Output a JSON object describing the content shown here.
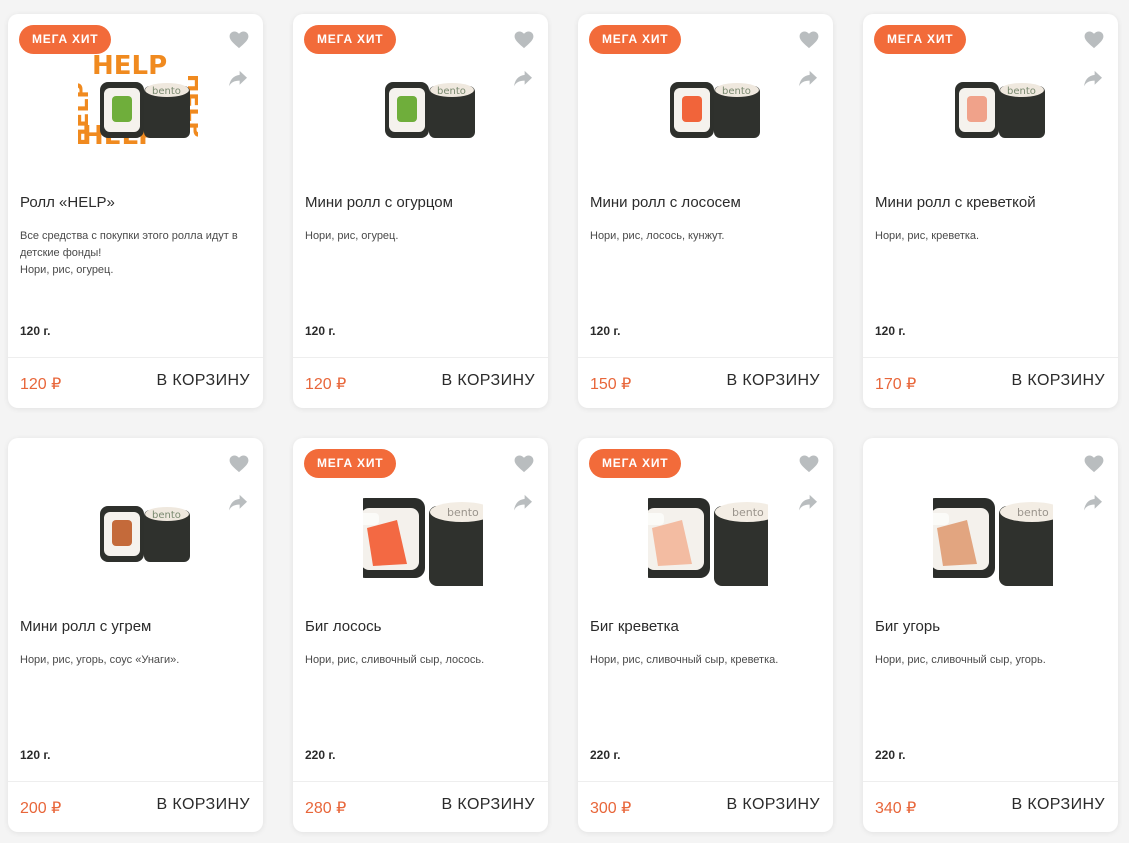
{
  "colors": {
    "accent": "#f26b3a",
    "price": "#e8663a",
    "icon": "#b9bdbf"
  },
  "products": [
    {
      "badge": "МЕГА ХИТ",
      "title": "Ролл «HELP»",
      "description": "Все средства с покупки этого ролла идут в детские фонды!\nНори, рис, огурец.",
      "weight": "120 г.",
      "price": "120 ₽",
      "cart": "В КОРЗИНУ",
      "filling": "cucumber",
      "watermark": "HELP"
    },
    {
      "badge": "МЕГА ХИТ",
      "title": "Мини ролл с огурцом",
      "description": "Нори, рис, огурец.",
      "weight": "120 г.",
      "price": "120 ₽",
      "cart": "В КОРЗИНУ",
      "filling": "cucumber"
    },
    {
      "badge": "МЕГА ХИТ",
      "title": "Мини ролл с лососем",
      "description": "Нори, рис, лосось, кунжут.",
      "weight": "120 г.",
      "price": "150 ₽",
      "cart": "В КОРЗИНУ",
      "filling": "salmon"
    },
    {
      "badge": "МЕГА ХИТ",
      "title": "Мини ролл с креветкой",
      "description": "Нори, рис, креветка.",
      "weight": "120 г.",
      "price": "170 ₽",
      "cart": "В КОРЗИНУ",
      "filling": "shrimp"
    },
    {
      "badge": "",
      "title": "Мини ролл с угрем",
      "description": "Нори, рис, угорь, соус «Унаги».",
      "weight": "120 г.",
      "price": "200 ₽",
      "cart": "В КОРЗИНУ",
      "filling": "eel"
    },
    {
      "badge": "МЕГА ХИТ",
      "title": "Биг лосось",
      "description": "Нори, рис, сливочный сыр, лосось.",
      "weight": "220 г.",
      "price": "280 ₽",
      "cart": "В КОРЗИНУ",
      "filling": "salmon-big"
    },
    {
      "badge": "МЕГА ХИТ",
      "title": "Биг креветка",
      "description": "Нори, рис, сливочный сыр, креветка.",
      "weight": "220 г.",
      "price": "300 ₽",
      "cart": "В КОРЗИНУ",
      "filling": "shrimp-big"
    },
    {
      "badge": "",
      "title": "Биг угорь",
      "description": "Нори, рис, сливочный сыр, угорь.",
      "weight": "220 г.",
      "price": "340 ₽",
      "cart": "В КОРЗИНУ",
      "filling": "eel-big"
    }
  ],
  "roll_label": "bento"
}
